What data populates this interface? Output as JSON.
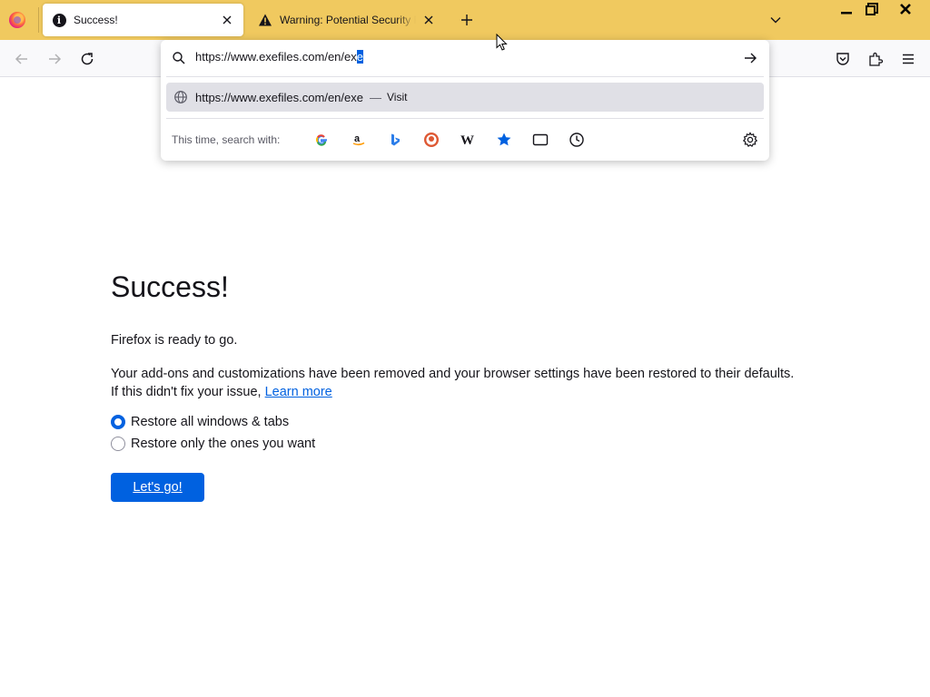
{
  "colors": {
    "tabstrip": "#f0c95f",
    "accent": "#0061e0",
    "text": "#15141a"
  },
  "tabs": [
    {
      "title": "Success!",
      "icon": "info-icon",
      "active": true
    },
    {
      "title": "Warning: Potential Security Risk Ahead",
      "icon": "warning-icon",
      "active": false
    }
  ],
  "urlbar": {
    "value_prefix": "https://www.exefiles.com/en/ex",
    "value_selected": "e",
    "result": {
      "url": "https://www.exefiles.com/en/exe",
      "separator": "—",
      "action": "Visit"
    },
    "oneoff_label": "This time, search with:",
    "engines": [
      "google-icon",
      "amazon-icon",
      "bing-icon",
      "duckduckgo-icon",
      "wikipedia-icon",
      "bookmarks-icon",
      "tabs-icon",
      "history-icon"
    ]
  },
  "page": {
    "title": "Success!",
    "ready_text": "Firefox is ready to go.",
    "body_line1": "Your add-ons and customizations have been removed and your browser settings have been restored to their defaults.",
    "body_line2_prefix": "If this didn't fix your issue, ",
    "learn_more": "Learn more",
    "options": [
      {
        "label": "Restore all windows & tabs",
        "checked": true
      },
      {
        "label": "Restore only the ones you want",
        "checked": false
      }
    ],
    "button_label": "Let's go!"
  }
}
